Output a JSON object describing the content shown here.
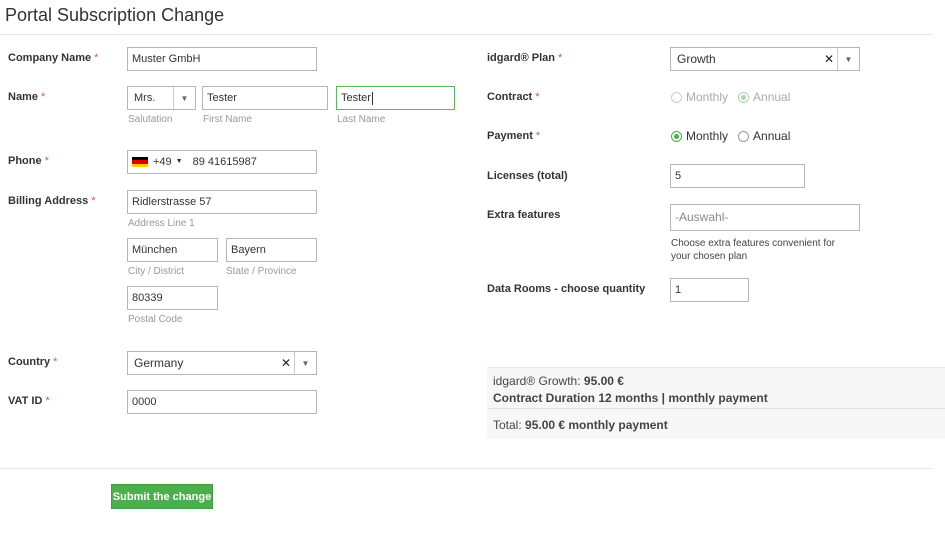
{
  "page": {
    "title": "Portal Subscription Change"
  },
  "left": {
    "company": {
      "label": "Company Name",
      "value": "Muster GmbH"
    },
    "name": {
      "label": "Name",
      "salutation": "Mrs.",
      "salutation_hint": "Salutation",
      "first_name": "Tester",
      "first_name_hint": "First Name",
      "last_name": "Tester",
      "last_name_hint": "Last Name"
    },
    "phone": {
      "label": "Phone",
      "country_code": "+49",
      "country_icon": "german-flag-icon",
      "number": "89 41615987"
    },
    "billing": {
      "label": "Billing Address",
      "address_line1": "Ridlerstrasse 57",
      "address_line1_hint": "Address Line 1",
      "city": "München",
      "city_hint": "City / District",
      "state": "Bayern",
      "state_hint": "State / Province",
      "postal": "80339",
      "postal_hint": "Postal Code"
    },
    "country": {
      "label": "Country",
      "value": "Germany"
    },
    "vat": {
      "label": "VAT ID",
      "value": "0000"
    }
  },
  "right": {
    "plan": {
      "label": "idgard® Plan",
      "value": "Growth"
    },
    "contract": {
      "label": "Contract",
      "options": [
        "Monthly",
        "Annual"
      ],
      "selected": "Annual",
      "disabled": true
    },
    "payment": {
      "label": "Payment",
      "options": [
        "Monthly",
        "Annual"
      ],
      "selected": "Monthly"
    },
    "licenses": {
      "label": "Licenses (total)",
      "value": "5"
    },
    "extras": {
      "label": "Extra features",
      "placeholder": "-Auswahl-",
      "help_line1": "Choose extra features convenient for",
      "help_line2": "your chosen plan"
    },
    "datarooms": {
      "label": "Data Rooms - choose quantity",
      "value": "1"
    }
  },
  "summary": {
    "plan_prefix": "idgard® Growth: ",
    "plan_price": "95.00 €",
    "duration": "Contract Duration 12 months | monthly payment",
    "total_prefix": "Total: ",
    "total_value": "95.00 € monthly payment"
  },
  "actions": {
    "submit_label": "Submit the change"
  },
  "colors": {
    "accent": "#4cae4c",
    "required": "#d9534f",
    "border": "#b5b5b5"
  }
}
